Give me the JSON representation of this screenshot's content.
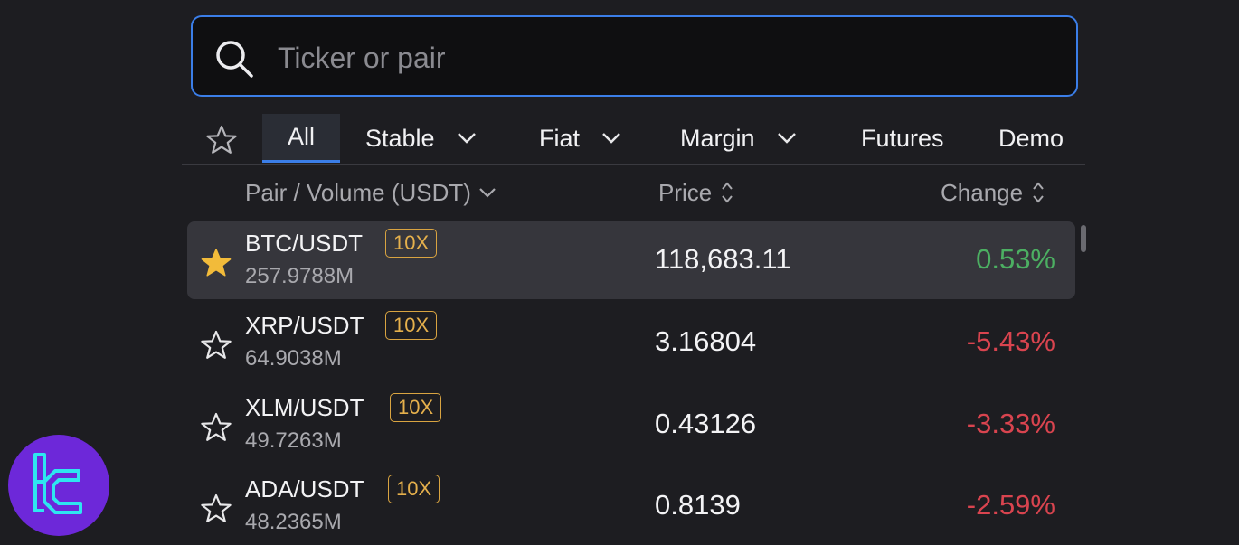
{
  "search": {
    "placeholder": "Ticker or pair",
    "value": ""
  },
  "tabs": {
    "favorites_icon": "star-outline-icon",
    "items": [
      {
        "label": "All",
        "active": true,
        "has_dropdown": false
      },
      {
        "label": "Stable",
        "active": false,
        "has_dropdown": true
      },
      {
        "label": "Fiat",
        "active": false,
        "has_dropdown": true
      },
      {
        "label": "Margin",
        "active": false,
        "has_dropdown": true
      },
      {
        "label": "Futures",
        "active": false,
        "has_dropdown": false
      },
      {
        "label": "Demo",
        "active": false,
        "has_dropdown": false
      }
    ]
  },
  "columns": {
    "pair_volume": "Pair / Volume (USDT)",
    "price": "Price",
    "change": "Change"
  },
  "rows": [
    {
      "pair": "BTC/USDT",
      "leverage": "10X",
      "volume": "257.9788M",
      "price": "118,683.11",
      "change": "0.53%",
      "favorite": true,
      "direction": "up"
    },
    {
      "pair": "XRP/USDT",
      "leverage": "10X",
      "volume": "64.9038M",
      "price": "3.16804",
      "change": "-5.43%",
      "favorite": false,
      "direction": "down"
    },
    {
      "pair": "XLM/USDT",
      "leverage": "10X",
      "volume": "49.7263M",
      "price": "0.43126",
      "change": "-3.33%",
      "favorite": false,
      "direction": "down"
    },
    {
      "pair": "ADA/USDT",
      "leverage": "10X",
      "volume": "48.2365M",
      "price": "0.8139",
      "change": "-2.59%",
      "favorite": false,
      "direction": "down"
    }
  ],
  "colors": {
    "accent": "#3b7ee8",
    "positive": "#4caf62",
    "negative": "#d9444f",
    "star_filled": "#f2bb3a",
    "leverage_badge": "#d9a441",
    "logo_bg": "#6d28d9",
    "logo_mark": "#2ee6f0"
  }
}
